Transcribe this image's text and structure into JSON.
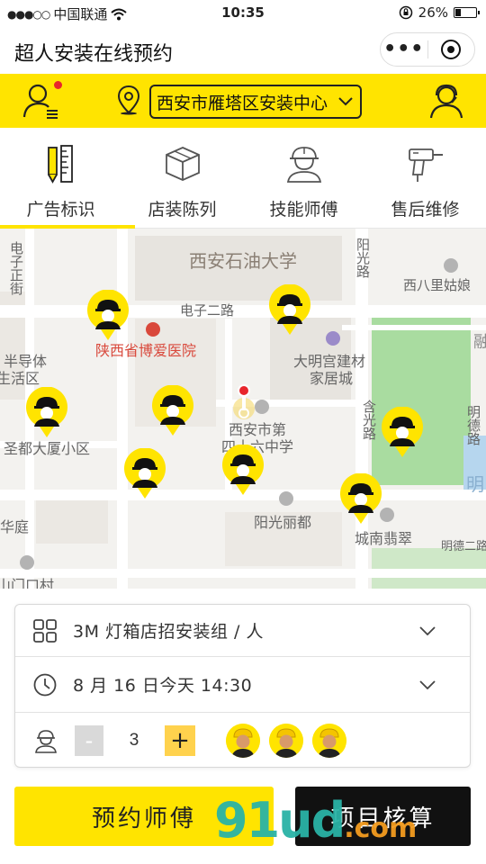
{
  "status_bar": {
    "carrier": "中国联通",
    "signal_dots": "●●●○○",
    "time": "10:35",
    "battery": "26%",
    "icons": [
      "wifi-icon",
      "rotation-lock-icon",
      "battery-icon"
    ]
  },
  "nav_bar": {
    "title": "超人安装在线预约",
    "more_label": "•••",
    "icons": [
      "more-icon",
      "close-target-icon"
    ]
  },
  "header": {
    "location": "西安市雁塔区安装中心",
    "icons": [
      "user-message-icon",
      "location-pin-icon",
      "dropdown-chevron-icon",
      "customer-service-icon"
    ],
    "accent_color": "#ffe400"
  },
  "categories": [
    {
      "label": "广告标识",
      "icon": "pencil-ruler-icon",
      "active": true
    },
    {
      "label": "店装陈列",
      "icon": "box-icon",
      "active": false
    },
    {
      "label": "技能师傅",
      "icon": "worker-helmet-icon",
      "active": false
    },
    {
      "label": "售后维修",
      "icon": "drill-icon",
      "active": false
    }
  ],
  "map": {
    "labels": {
      "university": "西安石油大学",
      "road_dianzi_er": "电子二路",
      "road_dianzi_zheng": "电子正街",
      "road_yangguang": "阳光路",
      "xibali": "西八里姑娘",
      "hospital": "陕西省博爱医院",
      "daming": "大明宫建材",
      "jiaju": "家居城",
      "bandaoti": "半导体",
      "shenghuo": "生活区",
      "school_1": "西安市第",
      "school_2": "四十六中学",
      "hanguang": "含光路",
      "mingde_v": "明德路",
      "shengdu": "圣都大厦小区",
      "yangguang_lidu": "阳光丽都",
      "chengnan": "城南翡翠",
      "mingde_h": "明德二路",
      "huating": "华庭",
      "shanmen": "山门口村",
      "ming": "明",
      "rong": "融"
    },
    "worker_marker_count": 8,
    "current_location_marker": "location-pin-red-icon"
  },
  "form": {
    "service": {
      "icon": "grid-icon",
      "value": "3M 灯箱店招安装组 / 人"
    },
    "datetime": {
      "icon": "clock-icon",
      "value": "8 月 16 日今天 14:30"
    },
    "workers": {
      "icon": "worker-icon",
      "minus": "-",
      "plus": "+",
      "quantity": "3",
      "avatars": 3
    }
  },
  "buttons": {
    "book": "预约师傅",
    "calculate": "项目核算"
  },
  "watermark": {
    "main": "91ud",
    "suffix": ".com"
  }
}
